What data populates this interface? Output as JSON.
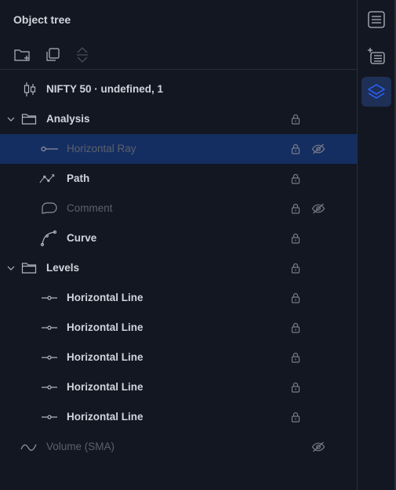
{
  "panel": {
    "title": "Object tree"
  },
  "toolbar": {
    "create_group": "folder-plus-icon",
    "clone": "clone-icon",
    "move": "move-updown-icon"
  },
  "tree": {
    "symbol": {
      "label": "NIFTY 50 · undefined, 1"
    },
    "groups": [
      {
        "label": "Analysis",
        "items": [
          {
            "label": "Horizontal Ray",
            "hidden": true,
            "selected": true
          },
          {
            "label": "Path"
          },
          {
            "label": "Comment",
            "hidden": true
          },
          {
            "label": "Curve"
          }
        ]
      },
      {
        "label": "Levels",
        "items": [
          {
            "label": "Horizontal Line"
          },
          {
            "label": "Horizontal Line"
          },
          {
            "label": "Horizontal Line"
          },
          {
            "label": "Horizontal Line"
          },
          {
            "label": "Horizontal Line"
          }
        ]
      }
    ],
    "indicator": {
      "label": "Volume (SMA)",
      "hidden": true
    }
  },
  "colors": {
    "background": "#131722",
    "selected_row": "#142e61",
    "text": "#d1d4dc",
    "muted_text": "#5d606b",
    "icon": "#787b86",
    "accent": "#2962ff",
    "rail_active": "#1e3056"
  }
}
